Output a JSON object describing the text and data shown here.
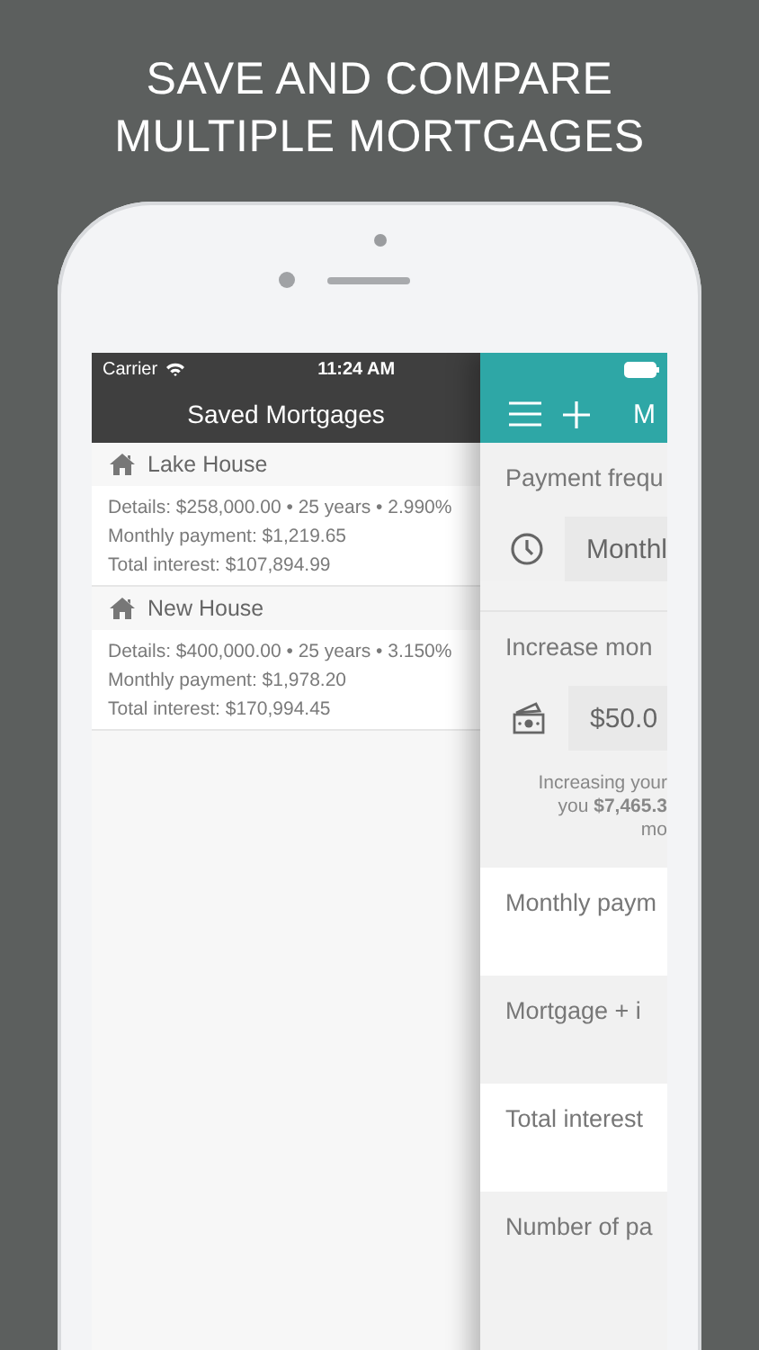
{
  "headline": [
    "SAVE AND COMPARE",
    "MULTIPLE MORTGAGES"
  ],
  "status_bar": {
    "carrier": "Carrier",
    "time": "11:24 AM"
  },
  "left_panel": {
    "title": "Saved Mortgages",
    "mortgages": [
      {
        "name": "Lake House",
        "details": "Details: $258,000.00 • 25 years • 2.990%",
        "monthly": "Monthly payment: $1,219.65",
        "interest": "Total interest: $107,894.99"
      },
      {
        "name": "New House",
        "details": "Details: $400,000.00 • 25 years • 3.150%",
        "monthly": "Monthly payment: $1,978.20",
        "interest": "Total interest: $170,994.45"
      }
    ]
  },
  "right_panel": {
    "title": "M",
    "payment_frequency": {
      "label": "Payment frequ",
      "value": "Monthl"
    },
    "increase": {
      "label": "Increase mon",
      "value": "$50.0",
      "note": [
        "Increasing your",
        "you **$7,465.3**",
        "mo"
      ]
    },
    "results": [
      {
        "label": "Monthly paym"
      },
      {
        "label": "Mortgage + i"
      },
      {
        "label": "Total interest"
      },
      {
        "label": "Number of pa"
      }
    ]
  }
}
